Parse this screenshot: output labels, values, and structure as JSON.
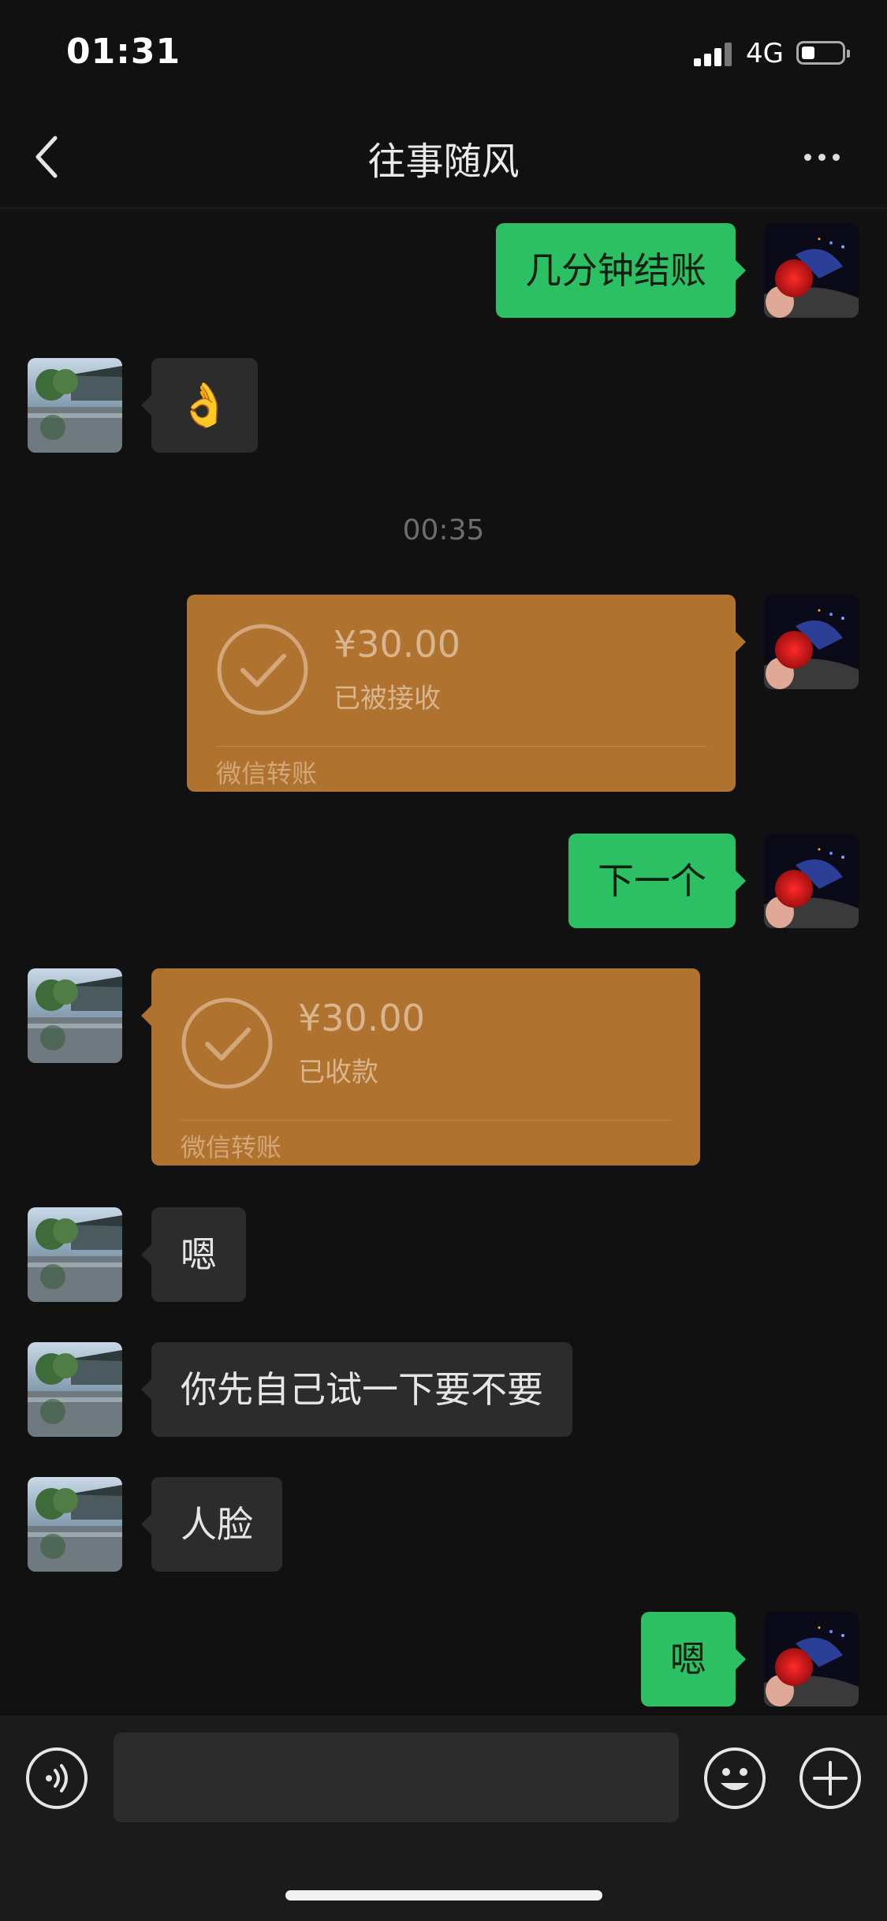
{
  "status_bar": {
    "time": "01:31",
    "network": "4G",
    "battery_icon": "battery-low-icon",
    "signal_icon": "signal-bars-icon"
  },
  "header": {
    "title": "往事随风",
    "back_icon": "chevron-left-icon",
    "more_icon": "ellipsis-icon"
  },
  "messages": [
    {
      "type": "text",
      "sender": "me",
      "text": "几分钟结账"
    },
    {
      "type": "emoji",
      "sender": "other",
      "text": "👌"
    },
    {
      "type": "timestamp",
      "text": "00:35"
    },
    {
      "type": "transfer",
      "sender": "me",
      "amount": "¥30.00",
      "status": "已被接收",
      "footer": "微信转账"
    },
    {
      "type": "text",
      "sender": "me",
      "text": "下一个"
    },
    {
      "type": "transfer",
      "sender": "other",
      "amount": "¥30.00",
      "status": "已收款",
      "footer": "微信转账"
    },
    {
      "type": "text",
      "sender": "other",
      "text": "嗯"
    },
    {
      "type": "text",
      "sender": "other",
      "text": "你先自己试一下要不要"
    },
    {
      "type": "text",
      "sender": "other",
      "text": "人脸"
    },
    {
      "type": "text",
      "sender": "me",
      "text": "嗯"
    }
  ],
  "input_bar": {
    "voice_icon": "voice-icon",
    "emoji_icon": "smiley-icon",
    "plus_icon": "plus-icon"
  },
  "colors": {
    "background": "#111111",
    "my_bubble": "#2dbf64",
    "other_bubble": "#2c2c2c",
    "transfer_card": "#b0722f"
  }
}
